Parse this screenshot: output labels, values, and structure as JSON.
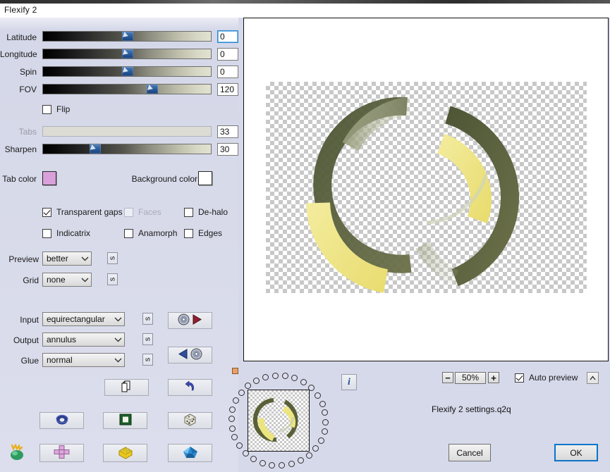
{
  "window": {
    "title": "Flexify 2"
  },
  "sliders": [
    {
      "name": "Latitude",
      "value": "0",
      "pos": 0.5,
      "disabled": false,
      "focused": true
    },
    {
      "name": "Longitude",
      "value": "0",
      "pos": 0.5,
      "disabled": false,
      "focused": false
    },
    {
      "name": "Spin",
      "value": "0",
      "pos": 0.5,
      "disabled": false,
      "focused": false
    },
    {
      "name": "FOV",
      "value": "120",
      "pos": 0.65,
      "disabled": false,
      "focused": false
    },
    {
      "name": "Tabs",
      "value": "33",
      "pos": 0.33,
      "disabled": true,
      "focused": false
    },
    {
      "name": "Sharpen",
      "value": "30",
      "pos": 0.3,
      "disabled": false,
      "focused": false
    }
  ],
  "flip": {
    "label": "Flip",
    "checked": false
  },
  "colors": {
    "tab_label": "Tab color",
    "tab_value": "#d9a0d9",
    "background_label": "Background color",
    "background_value": "#ffffff"
  },
  "checkboxes": [
    {
      "label": "Transparent gaps",
      "checked": true,
      "disabled": false
    },
    {
      "label": "Faces",
      "checked": false,
      "disabled": true
    },
    {
      "label": "De-halo",
      "checked": false,
      "disabled": false
    },
    {
      "label": "Indicatrix",
      "checked": false,
      "disabled": false
    },
    {
      "label": "Anamorph",
      "checked": false,
      "disabled": false
    },
    {
      "label": "Edges",
      "checked": false,
      "disabled": false
    }
  ],
  "selects": [
    {
      "label": "Preview",
      "value": "better",
      "reset": "s"
    },
    {
      "label": "Grid",
      "value": "none",
      "reset": "s"
    },
    {
      "label": "Input",
      "value": "equirectangular",
      "reset": "s"
    },
    {
      "label": "Output",
      "value": "annulus",
      "reset": "s"
    },
    {
      "label": "Glue",
      "value": "normal",
      "reset": "s"
    }
  ],
  "icon_buttons": [
    {
      "name": "load-settings",
      "icon": "disc-arrow"
    },
    {
      "name": "save-settings",
      "icon": "arrow-disc"
    },
    {
      "name": "copy",
      "icon": "pages"
    },
    {
      "name": "undo",
      "icon": "undo-arrow"
    },
    {
      "name": "shape-torus",
      "icon": "blue-torus"
    },
    {
      "name": "shape-frame",
      "icon": "green-frame"
    },
    {
      "name": "shape-dice",
      "icon": "white-dice"
    },
    {
      "name": "shape-cross",
      "icon": "pink-cross"
    },
    {
      "name": "shape-brick",
      "icon": "yellow-brick"
    },
    {
      "name": "shape-gem",
      "icon": "blue-gem"
    }
  ],
  "zoom": {
    "minus": "−",
    "value": "50%",
    "plus": "+",
    "auto_preview_label": "Auto preview",
    "auto_preview_checked": true,
    "caret": "∧"
  },
  "settings_file": "Flexify 2 settings.q2q",
  "buttons": {
    "cancel": "Cancel",
    "ok": "OK"
  },
  "info_button": {
    "glyph": "i"
  },
  "accent": "#0a74c8"
}
